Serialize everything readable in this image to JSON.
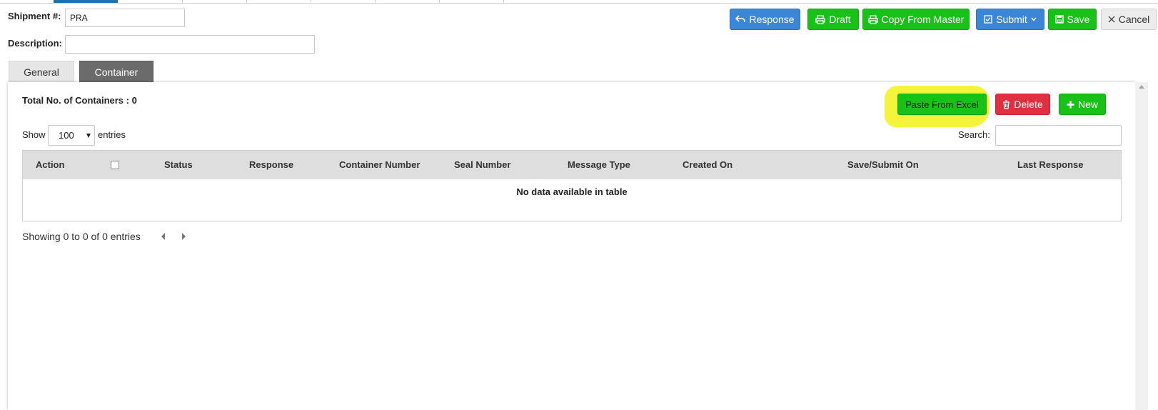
{
  "form": {
    "shipment_label": "Shipment #:",
    "shipment_value": "PRA",
    "description_label": "Description:",
    "description_value": ""
  },
  "toolbar": {
    "response": "Response",
    "draft": "Draft",
    "copy_from_master": "Copy From Master",
    "submit": "Submit",
    "save": "Save",
    "cancel": "Cancel"
  },
  "tabs": {
    "general": "General",
    "container": "Container"
  },
  "container": {
    "total_label": "Total No. of Containers : 0",
    "paste_from_excel": "Paste From Excel",
    "delete": "Delete",
    "new": "New",
    "show_label": "Show",
    "entries_label": "entries",
    "page_size": "100",
    "search_label": "Search:",
    "search_value": "",
    "columns": [
      "Action",
      "Status",
      "Response",
      "Container Number",
      "Seal Number",
      "Message Type",
      "Created On",
      "Save/Submit On",
      "Last Response"
    ],
    "empty_message": "No data available in table",
    "info": "Showing 0 to 0 of 0 entries"
  },
  "colors": {
    "blue": "#3c86d8",
    "green": "#17c117",
    "red": "#e0303f",
    "highlight": "#f4f43a",
    "tab_active": "#6b6b6b"
  }
}
